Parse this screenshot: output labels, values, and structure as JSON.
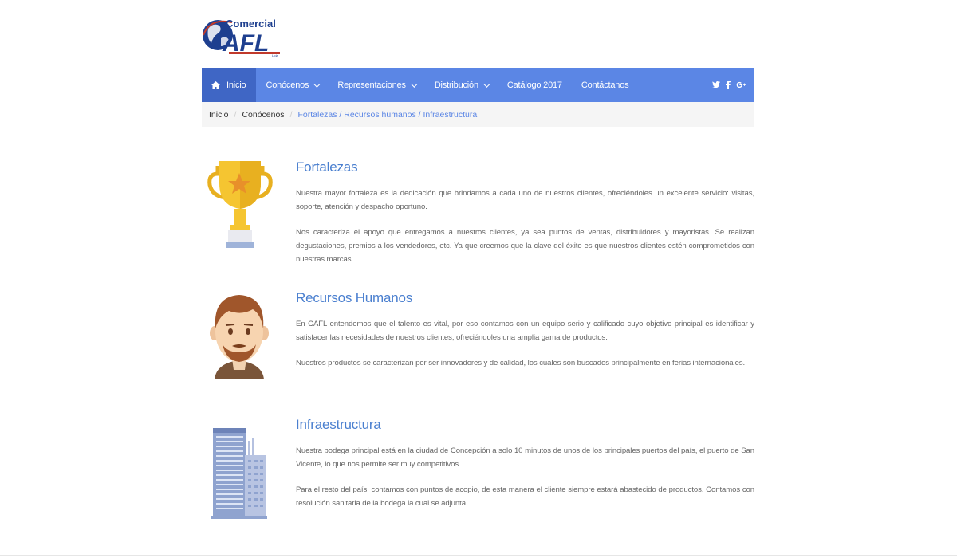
{
  "logo": {
    "top_text": "Comercial",
    "main_text": "AFL",
    "sub_text": "Ltda"
  },
  "navbar": {
    "items": [
      {
        "label": "Inicio",
        "icon": "home-icon",
        "active": true
      },
      {
        "label": "Conócenos",
        "dropdown": true
      },
      {
        "label": "Representaciones",
        "dropdown": true
      },
      {
        "label": "Distribución",
        "dropdown": true
      },
      {
        "label": "Catálogo 2017"
      },
      {
        "label": "Contáctanos"
      }
    ],
    "social": [
      "twitter-icon",
      "facebook-icon",
      "google-plus-icon"
    ],
    "colors": {
      "bar": "#5b86e5",
      "active": "#3f66c5"
    }
  },
  "breadcrumb": {
    "items": [
      "Inicio",
      "Conócenos"
    ],
    "current": "Fortalezas / Recursos humanos / Infraestructura"
  },
  "sections": [
    {
      "icon": "trophy-icon",
      "title": "Fortalezas",
      "paragraphs": [
        "Nuestra mayor fortaleza es la dedicación que brindamos a cada uno de nuestros clientes, ofreciéndoles un excelente servicio: visitas, soporte, atención y despacho oportuno.",
        "Nos caracteriza el apoyo que entregamos a nuestros clientes, ya sea puntos de ventas, distribuidores y mayoristas. Se realizan degustaciones, premios a los vendedores, etc. Ya que creemos que la clave del éxito es que nuestros clientes estén comprometidos con nuestras marcas."
      ]
    },
    {
      "icon": "person-icon",
      "title": "Recursos Humanos",
      "paragraphs": [
        "En CAFL entendemos que el talento es vital, por eso contamos con un equipo serio y calificado cuyo objetivo principal es identificar y satisfacer las necesidades de nuestros clientes, ofreciéndoles una amplia gama de productos.",
        "Nuestros productos se caracterizan por ser innovadores y de calidad, los cuales son buscados principalmente en ferias internacionales."
      ]
    },
    {
      "icon": "building-icon",
      "title": "Infraestructura",
      "paragraphs": [
        "Nuestra bodega principal está en la ciudad de Concepción a solo 10 minutos de unos de los principales puertos del país, el puerto de San Vicente, lo que nos permite ser muy competitivos.",
        "Para el resto del país, contamos con puntos de acopio, de esta manera el cliente siempre estará abastecido de productos. Contamos con resolución sanitaria de la bodega la cual se adjunta."
      ]
    }
  ]
}
